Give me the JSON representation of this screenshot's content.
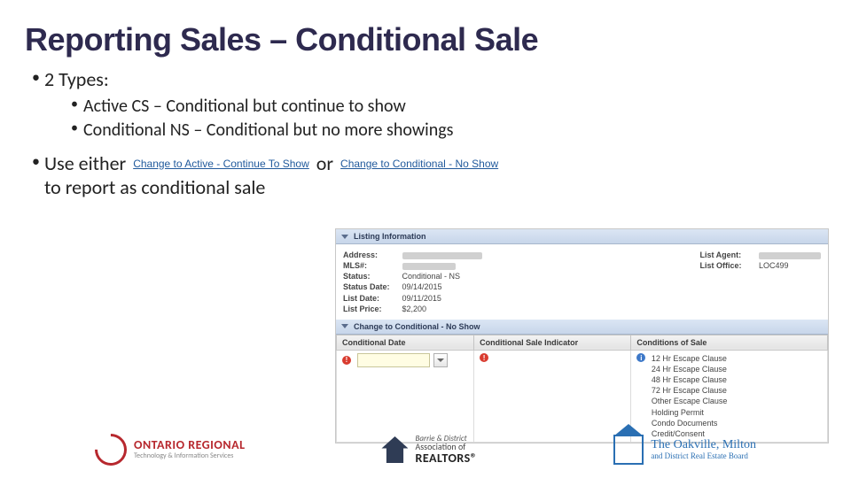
{
  "title": "Reporting Sales – Conditional Sale",
  "bullets": {
    "types_heading": "2 Types:",
    "type_a": "Active CS – Conditional but continue to show",
    "type_b": "Conditional NS – Conditional but no more showings",
    "use_prefix": "Use either",
    "use_or": "or",
    "use_suffix": "to report as conditional sale"
  },
  "links": {
    "active_show": "Change to Active - Continue To Show",
    "cond_noshow": "Change to Conditional - No Show"
  },
  "shot": {
    "section1": "Listing Information",
    "fields": {
      "address": "Address:",
      "mls": "MLS#:",
      "status": "Status:",
      "status_val": "Conditional - NS",
      "status_date": "Status Date:",
      "status_date_val": "09/14/2015",
      "list_date": "List Date:",
      "list_date_val": "09/11/2015",
      "list_price": "List Price:",
      "list_price_val": "$2,200",
      "list_agent": "List Agent:",
      "list_office": "List Office:",
      "list_office_val": "LOC499"
    },
    "section2": "Change to Conditional - No Show",
    "cols": {
      "c1": "Conditional Date",
      "c2": "Conditional Sale Indicator",
      "c3": "Conditions of Sale"
    },
    "conditions": [
      "12 Hr Escape Clause",
      "24 Hr Escape Clause",
      "48 Hr Escape Clause",
      "72 Hr Escape Clause",
      "Other Escape Clause",
      "Holding Permit",
      "Condo Documents",
      "Credit/Consent"
    ]
  },
  "logos": {
    "ontario": {
      "a": "ONTARIO REGIONAL",
      "b": "Technology & Information Services"
    },
    "barrie": {
      "a": "Barrie & District",
      "b": "Association of",
      "c": "REALTORS®"
    },
    "oakville": {
      "a": "The Oakville, Milton",
      "b": "and District Real Estate Board"
    }
  }
}
